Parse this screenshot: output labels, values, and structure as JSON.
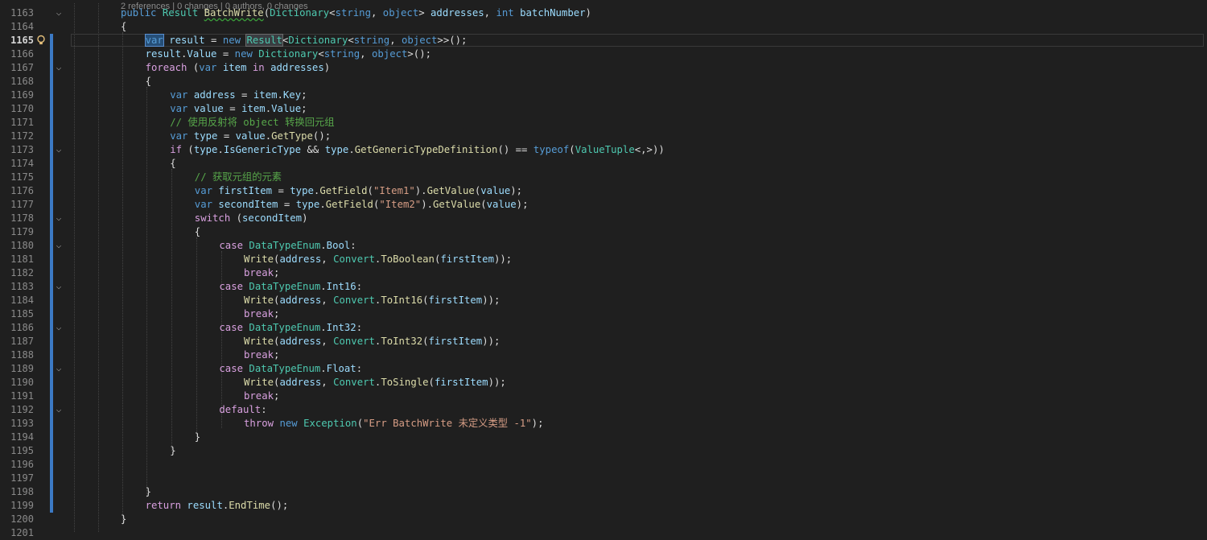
{
  "editor": {
    "codelens": "2 references | 0 changes | 0 authors, 0 changes",
    "current_line": "1165",
    "lines": [
      {
        "n": "1163",
        "fold": true,
        "indent": 0,
        "tokens": [
          [
            "kw",
            "public"
          ],
          [
            "pl",
            " "
          ],
          [
            "ty",
            "Result"
          ],
          [
            "pl",
            " "
          ],
          [
            "fn",
            "BatchWrite"
          ],
          [
            "pl",
            "("
          ],
          [
            "ty",
            "Dictionary"
          ],
          [
            "pl",
            "<"
          ],
          [
            "kw",
            "string"
          ],
          [
            "pl",
            ", "
          ],
          [
            "kw",
            "object"
          ],
          [
            "pl",
            "> "
          ],
          [
            "vr",
            "addresses"
          ],
          [
            "pl",
            ", "
          ],
          [
            "kw",
            "int"
          ],
          [
            "pl",
            " "
          ],
          [
            "vr",
            "batchNumber"
          ],
          [
            "pl",
            ")"
          ]
        ]
      },
      {
        "n": "1164",
        "fold": false,
        "indent": 0,
        "tokens": [
          [
            "pl",
            "{"
          ]
        ]
      },
      {
        "n": "1165",
        "fold": false,
        "indent": 1,
        "tokens": [
          [
            "kw",
            "var"
          ],
          [
            "pl",
            " "
          ],
          [
            "vr",
            "result"
          ],
          [
            "pl",
            " = "
          ],
          [
            "kw",
            "new"
          ],
          [
            "pl",
            " "
          ],
          [
            "ty",
            "Result"
          ],
          [
            "pl",
            "<"
          ],
          [
            "ty",
            "Dictionary"
          ],
          [
            "pl",
            "<"
          ],
          [
            "kw",
            "string"
          ],
          [
            "pl",
            ", "
          ],
          [
            "kw",
            "object"
          ],
          [
            "pl",
            ">>();"
          ]
        ]
      },
      {
        "n": "1166",
        "fold": false,
        "indent": 1,
        "tokens": [
          [
            "vr",
            "result"
          ],
          [
            "pl",
            "."
          ],
          [
            "vr",
            "Value"
          ],
          [
            "pl",
            " = "
          ],
          [
            "kw",
            "new"
          ],
          [
            "pl",
            " "
          ],
          [
            "ty",
            "Dictionary"
          ],
          [
            "pl",
            "<"
          ],
          [
            "kw",
            "string"
          ],
          [
            "pl",
            ", "
          ],
          [
            "kw",
            "object"
          ],
          [
            "pl",
            ">();"
          ]
        ]
      },
      {
        "n": "1167",
        "fold": true,
        "indent": 1,
        "tokens": [
          [
            "ctl",
            "foreach"
          ],
          [
            "pl",
            " ("
          ],
          [
            "kw",
            "var"
          ],
          [
            "pl",
            " "
          ],
          [
            "vr",
            "item"
          ],
          [
            "pl",
            " "
          ],
          [
            "ctl",
            "in"
          ],
          [
            "pl",
            " "
          ],
          [
            "vr",
            "addresses"
          ],
          [
            "pl",
            ")"
          ]
        ]
      },
      {
        "n": "1168",
        "fold": false,
        "indent": 1,
        "tokens": [
          [
            "pl",
            "{"
          ]
        ]
      },
      {
        "n": "1169",
        "fold": false,
        "indent": 2,
        "tokens": [
          [
            "kw",
            "var"
          ],
          [
            "pl",
            " "
          ],
          [
            "vr",
            "address"
          ],
          [
            "pl",
            " = "
          ],
          [
            "vr",
            "item"
          ],
          [
            "pl",
            "."
          ],
          [
            "vr",
            "Key"
          ],
          [
            "pl",
            ";"
          ]
        ]
      },
      {
        "n": "1170",
        "fold": false,
        "indent": 2,
        "tokens": [
          [
            "kw",
            "var"
          ],
          [
            "pl",
            " "
          ],
          [
            "vr",
            "value"
          ],
          [
            "pl",
            " = "
          ],
          [
            "vr",
            "item"
          ],
          [
            "pl",
            "."
          ],
          [
            "vr",
            "Value"
          ],
          [
            "pl",
            ";"
          ]
        ]
      },
      {
        "n": "1171",
        "fold": false,
        "indent": 2,
        "tokens": [
          [
            "cm",
            "// 使用反射将 object 转换回元组"
          ]
        ]
      },
      {
        "n": "1172",
        "fold": false,
        "indent": 2,
        "tokens": [
          [
            "kw",
            "var"
          ],
          [
            "pl",
            " "
          ],
          [
            "vr",
            "type"
          ],
          [
            "pl",
            " = "
          ],
          [
            "vr",
            "value"
          ],
          [
            "pl",
            "."
          ],
          [
            "fn",
            "GetType"
          ],
          [
            "pl",
            "();"
          ]
        ]
      },
      {
        "n": "1173",
        "fold": true,
        "indent": 2,
        "tokens": [
          [
            "ctl",
            "if"
          ],
          [
            "pl",
            " ("
          ],
          [
            "vr",
            "type"
          ],
          [
            "pl",
            "."
          ],
          [
            "vr",
            "IsGenericType"
          ],
          [
            "pl",
            " && "
          ],
          [
            "vr",
            "type"
          ],
          [
            "pl",
            "."
          ],
          [
            "fn",
            "GetGenericTypeDefinition"
          ],
          [
            "pl",
            "() == "
          ],
          [
            "kw",
            "typeof"
          ],
          [
            "pl",
            "("
          ],
          [
            "ty",
            "ValueTuple"
          ],
          [
            "pl",
            "<,>))"
          ]
        ]
      },
      {
        "n": "1174",
        "fold": false,
        "indent": 2,
        "tokens": [
          [
            "pl",
            "{"
          ]
        ]
      },
      {
        "n": "1175",
        "fold": false,
        "indent": 3,
        "tokens": [
          [
            "cm",
            "// 获取元组的元素"
          ]
        ]
      },
      {
        "n": "1176",
        "fold": false,
        "indent": 3,
        "tokens": [
          [
            "kw",
            "var"
          ],
          [
            "pl",
            " "
          ],
          [
            "vr",
            "firstItem"
          ],
          [
            "pl",
            " = "
          ],
          [
            "vr",
            "type"
          ],
          [
            "pl",
            "."
          ],
          [
            "fn",
            "GetField"
          ],
          [
            "pl",
            "("
          ],
          [
            "str",
            "\"Item1\""
          ],
          [
            "pl",
            ")."
          ],
          [
            "fn",
            "GetValue"
          ],
          [
            "pl",
            "("
          ],
          [
            "vr",
            "value"
          ],
          [
            "pl",
            ");"
          ]
        ]
      },
      {
        "n": "1177",
        "fold": false,
        "indent": 3,
        "tokens": [
          [
            "kw",
            "var"
          ],
          [
            "pl",
            " "
          ],
          [
            "vr",
            "secondItem"
          ],
          [
            "pl",
            " = "
          ],
          [
            "vr",
            "type"
          ],
          [
            "pl",
            "."
          ],
          [
            "fn",
            "GetField"
          ],
          [
            "pl",
            "("
          ],
          [
            "str",
            "\"Item2\""
          ],
          [
            "pl",
            ")."
          ],
          [
            "fn",
            "GetValue"
          ],
          [
            "pl",
            "("
          ],
          [
            "vr",
            "value"
          ],
          [
            "pl",
            ");"
          ]
        ]
      },
      {
        "n": "1178",
        "fold": true,
        "indent": 3,
        "tokens": [
          [
            "ctl",
            "switch"
          ],
          [
            "pl",
            " ("
          ],
          [
            "vr",
            "secondItem"
          ],
          [
            "pl",
            ")"
          ]
        ]
      },
      {
        "n": "1179",
        "fold": false,
        "indent": 3,
        "tokens": [
          [
            "pl",
            "{"
          ]
        ]
      },
      {
        "n": "1180",
        "fold": true,
        "indent": 4,
        "tokens": [
          [
            "ctl",
            "case"
          ],
          [
            "pl",
            " "
          ],
          [
            "ty",
            "DataTypeEnum"
          ],
          [
            "pl",
            "."
          ],
          [
            "vr",
            "Bool"
          ],
          [
            "pl",
            ":"
          ]
        ]
      },
      {
        "n": "1181",
        "fold": false,
        "indent": 5,
        "tokens": [
          [
            "fn",
            "Write"
          ],
          [
            "pl",
            "("
          ],
          [
            "vr",
            "address"
          ],
          [
            "pl",
            ", "
          ],
          [
            "ty",
            "Convert"
          ],
          [
            "pl",
            "."
          ],
          [
            "fn",
            "ToBoolean"
          ],
          [
            "pl",
            "("
          ],
          [
            "vr",
            "firstItem"
          ],
          [
            "pl",
            "));"
          ]
        ]
      },
      {
        "n": "1182",
        "fold": false,
        "indent": 5,
        "tokens": [
          [
            "ctl",
            "break"
          ],
          [
            "pl",
            ";"
          ]
        ]
      },
      {
        "n": "1183",
        "fold": true,
        "indent": 4,
        "tokens": [
          [
            "ctl",
            "case"
          ],
          [
            "pl",
            " "
          ],
          [
            "ty",
            "DataTypeEnum"
          ],
          [
            "pl",
            "."
          ],
          [
            "vr",
            "Int16"
          ],
          [
            "pl",
            ":"
          ]
        ]
      },
      {
        "n": "1184",
        "fold": false,
        "indent": 5,
        "tokens": [
          [
            "fn",
            "Write"
          ],
          [
            "pl",
            "("
          ],
          [
            "vr",
            "address"
          ],
          [
            "pl",
            ", "
          ],
          [
            "ty",
            "Convert"
          ],
          [
            "pl",
            "."
          ],
          [
            "fn",
            "ToInt16"
          ],
          [
            "pl",
            "("
          ],
          [
            "vr",
            "firstItem"
          ],
          [
            "pl",
            "));"
          ]
        ]
      },
      {
        "n": "1185",
        "fold": false,
        "indent": 5,
        "tokens": [
          [
            "ctl",
            "break"
          ],
          [
            "pl",
            ";"
          ]
        ]
      },
      {
        "n": "1186",
        "fold": true,
        "indent": 4,
        "tokens": [
          [
            "ctl",
            "case"
          ],
          [
            "pl",
            " "
          ],
          [
            "ty",
            "DataTypeEnum"
          ],
          [
            "pl",
            "."
          ],
          [
            "vr",
            "Int32"
          ],
          [
            "pl",
            ":"
          ]
        ]
      },
      {
        "n": "1187",
        "fold": false,
        "indent": 5,
        "tokens": [
          [
            "fn",
            "Write"
          ],
          [
            "pl",
            "("
          ],
          [
            "vr",
            "address"
          ],
          [
            "pl",
            ", "
          ],
          [
            "ty",
            "Convert"
          ],
          [
            "pl",
            "."
          ],
          [
            "fn",
            "ToInt32"
          ],
          [
            "pl",
            "("
          ],
          [
            "vr",
            "firstItem"
          ],
          [
            "pl",
            "));"
          ]
        ]
      },
      {
        "n": "1188",
        "fold": false,
        "indent": 5,
        "tokens": [
          [
            "ctl",
            "break"
          ],
          [
            "pl",
            ";"
          ]
        ]
      },
      {
        "n": "1189",
        "fold": true,
        "indent": 4,
        "tokens": [
          [
            "ctl",
            "case"
          ],
          [
            "pl",
            " "
          ],
          [
            "ty",
            "DataTypeEnum"
          ],
          [
            "pl",
            "."
          ],
          [
            "vr",
            "Float"
          ],
          [
            "pl",
            ":"
          ]
        ]
      },
      {
        "n": "1190",
        "fold": false,
        "indent": 5,
        "tokens": [
          [
            "fn",
            "Write"
          ],
          [
            "pl",
            "("
          ],
          [
            "vr",
            "address"
          ],
          [
            "pl",
            ", "
          ],
          [
            "ty",
            "Convert"
          ],
          [
            "pl",
            "."
          ],
          [
            "fn",
            "ToSingle"
          ],
          [
            "pl",
            "("
          ],
          [
            "vr",
            "firstItem"
          ],
          [
            "pl",
            "));"
          ]
        ]
      },
      {
        "n": "1191",
        "fold": false,
        "indent": 5,
        "tokens": [
          [
            "ctl",
            "break"
          ],
          [
            "pl",
            ";"
          ]
        ]
      },
      {
        "n": "1192",
        "fold": true,
        "indent": 4,
        "tokens": [
          [
            "ctl",
            "default"
          ],
          [
            "pl",
            ":"
          ]
        ]
      },
      {
        "n": "1193",
        "fold": false,
        "indent": 5,
        "tokens": [
          [
            "ctl",
            "throw"
          ],
          [
            "pl",
            " "
          ],
          [
            "kw",
            "new"
          ],
          [
            "pl",
            " "
          ],
          [
            "ty",
            "Exception"
          ],
          [
            "pl",
            "("
          ],
          [
            "str",
            "\"Err BatchWrite 未定义类型 -1\""
          ],
          [
            "pl",
            ");"
          ]
        ]
      },
      {
        "n": "1194",
        "fold": false,
        "indent": 3,
        "tokens": [
          [
            "pl",
            "}"
          ]
        ]
      },
      {
        "n": "1195",
        "fold": false,
        "indent": 2,
        "tokens": [
          [
            "pl",
            "}"
          ]
        ]
      },
      {
        "n": "1196",
        "fold": false,
        "indent": 0,
        "tokens": []
      },
      {
        "n": "1197",
        "fold": false,
        "indent": 0,
        "tokens": []
      },
      {
        "n": "1198",
        "fold": false,
        "indent": 1,
        "tokens": [
          [
            "pl",
            "}"
          ]
        ]
      },
      {
        "n": "1199",
        "fold": false,
        "indent": 1,
        "tokens": [
          [
            "ctl",
            "return"
          ],
          [
            "pl",
            " "
          ],
          [
            "vr",
            "result"
          ],
          [
            "pl",
            "."
          ],
          [
            "fn",
            "EndTime"
          ],
          [
            "pl",
            "();"
          ]
        ]
      },
      {
        "n": "1200",
        "fold": false,
        "indent": 0,
        "tokens": [
          [
            "pl",
            "}"
          ]
        ]
      },
      {
        "n": "1201",
        "fold": false,
        "indent": 0,
        "tokens": []
      }
    ]
  }
}
